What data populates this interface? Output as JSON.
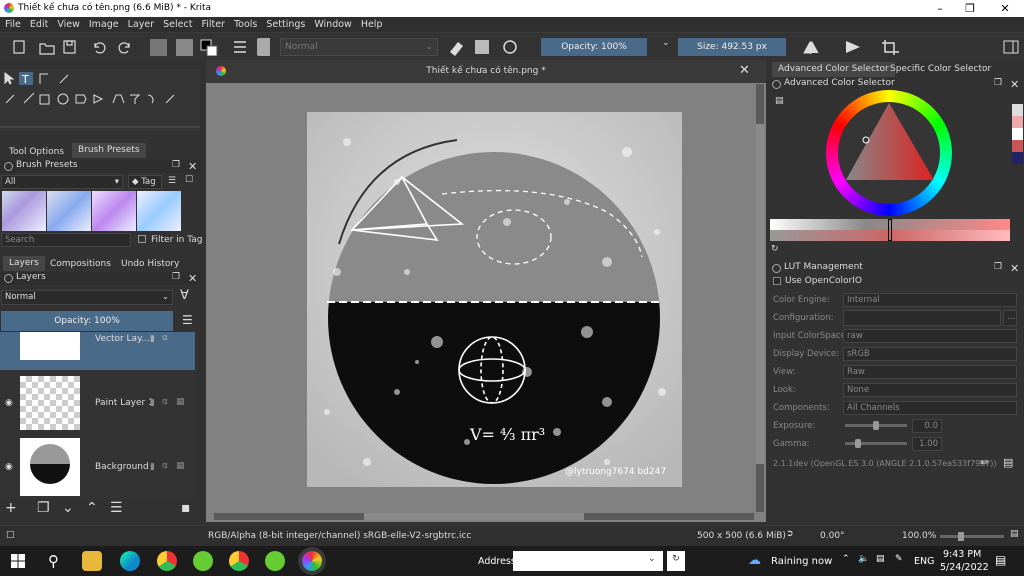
{
  "window": {
    "title": "Thiết kế chưa có tên.png (6.6 MiB)  * - Krita"
  },
  "menu": [
    "File",
    "Edit",
    "View",
    "Image",
    "Layer",
    "Select",
    "Filter",
    "Tools",
    "Settings",
    "Window",
    "Help"
  ],
  "toolbar": {
    "blend_mode": "Normal",
    "opacity": "Opacity: 100%",
    "size": "Size: 492.53 px"
  },
  "canvas": {
    "tab_title": "Thiết kế chưa có tên.png *",
    "signature": "@lytruong7674 bd247"
  },
  "left_dock": {
    "tabs": [
      "Tool Options",
      "Brush Presets"
    ],
    "brush_presets_title": "Brush Presets",
    "filter_all": "All",
    "tag_label": "Tag",
    "search_placeholder": "Search",
    "filter_in_tag": "Filter in Tag",
    "layer_tabs": [
      "Layers",
      "Compositions",
      "Undo History"
    ],
    "layers_title": "Layers",
    "layer_blend": "Normal",
    "layer_opacity": "Opacity:  100%",
    "layers": [
      {
        "name": "Vector Lay...",
        "selected": true
      },
      {
        "name": "Paint Layer 1",
        "selected": false
      },
      {
        "name": "Background",
        "selected": false
      }
    ]
  },
  "right_dock": {
    "tabs": [
      "Advanced Color Selector",
      "Specific Color Selector"
    ],
    "acs_title": "Advanced Color Selector",
    "lut_title": "LUT Management",
    "use_ocio": "Use OpenColorIO",
    "lut_rows": [
      {
        "label": "Color Engine:",
        "value": "Internal"
      },
      {
        "label": "Configuration:",
        "value": ""
      },
      {
        "label": "Input ColorSpace:",
        "value": "raw"
      },
      {
        "label": "Display Device:",
        "value": "sRGB"
      },
      {
        "label": "View:",
        "value": "Raw"
      },
      {
        "label": "Look:",
        "value": "None"
      },
      {
        "label": "Components:",
        "value": "All Channels"
      },
      {
        "label": "Exposure:",
        "value": "0.0"
      },
      {
        "label": "Gamma:",
        "value": "1.00"
      }
    ],
    "version": "2.1.1dev (OpenGL ES 3.0 (ANGLE 2.1.0.57ea533f79a7))"
  },
  "statusbar": {
    "colorspace": "RGB/Alpha (8-bit integer/channel)  sRGB-elle-V2-srgbtrc.icc",
    "dims": "500 x 500 (6.6 MiB)",
    "rotation": "0.00°",
    "zoom": "100.0%"
  },
  "taskbar": {
    "address_label": "Address",
    "weather": "Raining now",
    "lang": "ENG",
    "time": "9:43 PM",
    "date": "5/24/2022"
  }
}
